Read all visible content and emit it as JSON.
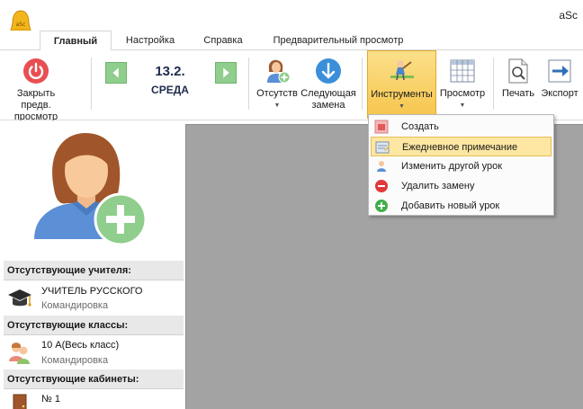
{
  "app": {
    "title": "aSc"
  },
  "tabs": [
    {
      "label": "Главный",
      "active": true
    },
    {
      "label": "Настройка",
      "active": false
    },
    {
      "label": "Справка",
      "active": false
    },
    {
      "label": "Предварительный просмотр",
      "active": false
    }
  ],
  "ribbon": {
    "close_preview": "Закрыть предв. просмотр",
    "date_number": "13.2.",
    "date_day": "СРЕДА",
    "absent": "Отсутств",
    "next_sub_line1": "Следующая",
    "next_sub_line2": "замена",
    "tools": "Инструменты",
    "view": "Просмотр",
    "print": "Печать",
    "export": "Экспорт"
  },
  "tools_menu": {
    "items": [
      {
        "label": "Создать",
        "icon": "create-icon",
        "highlighted": false
      },
      {
        "label": "Ежедневное примечание",
        "icon": "daily-note-icon",
        "highlighted": true
      },
      {
        "label": "Изменить другой урок",
        "icon": "change-lesson-icon",
        "highlighted": false
      },
      {
        "label": "Удалить замену",
        "icon": "remove-icon",
        "highlighted": false
      },
      {
        "label": "Добавить новый урок",
        "icon": "add-icon",
        "highlighted": false
      }
    ]
  },
  "left_panel": {
    "absent_teachers_header": "Отсутствующие учителя:",
    "teacher_name": "УЧИТЕЛЬ РУССКОГО",
    "teacher_reason": "Командировка",
    "absent_classes_header": "Отсутствующие классы:",
    "class_name": "10 А(Весь класс)",
    "class_reason": "Командировка",
    "absent_rooms_header": "Отсутствующие  кабинеты:",
    "room_name": "№ 1"
  },
  "colors": {
    "accent_orange": "#f6c54c",
    "nav_green": "#8fce8c",
    "close_red": "#e84f52",
    "next_blue": "#3b8fd8",
    "canvas_grey": "#a3a3a3"
  }
}
